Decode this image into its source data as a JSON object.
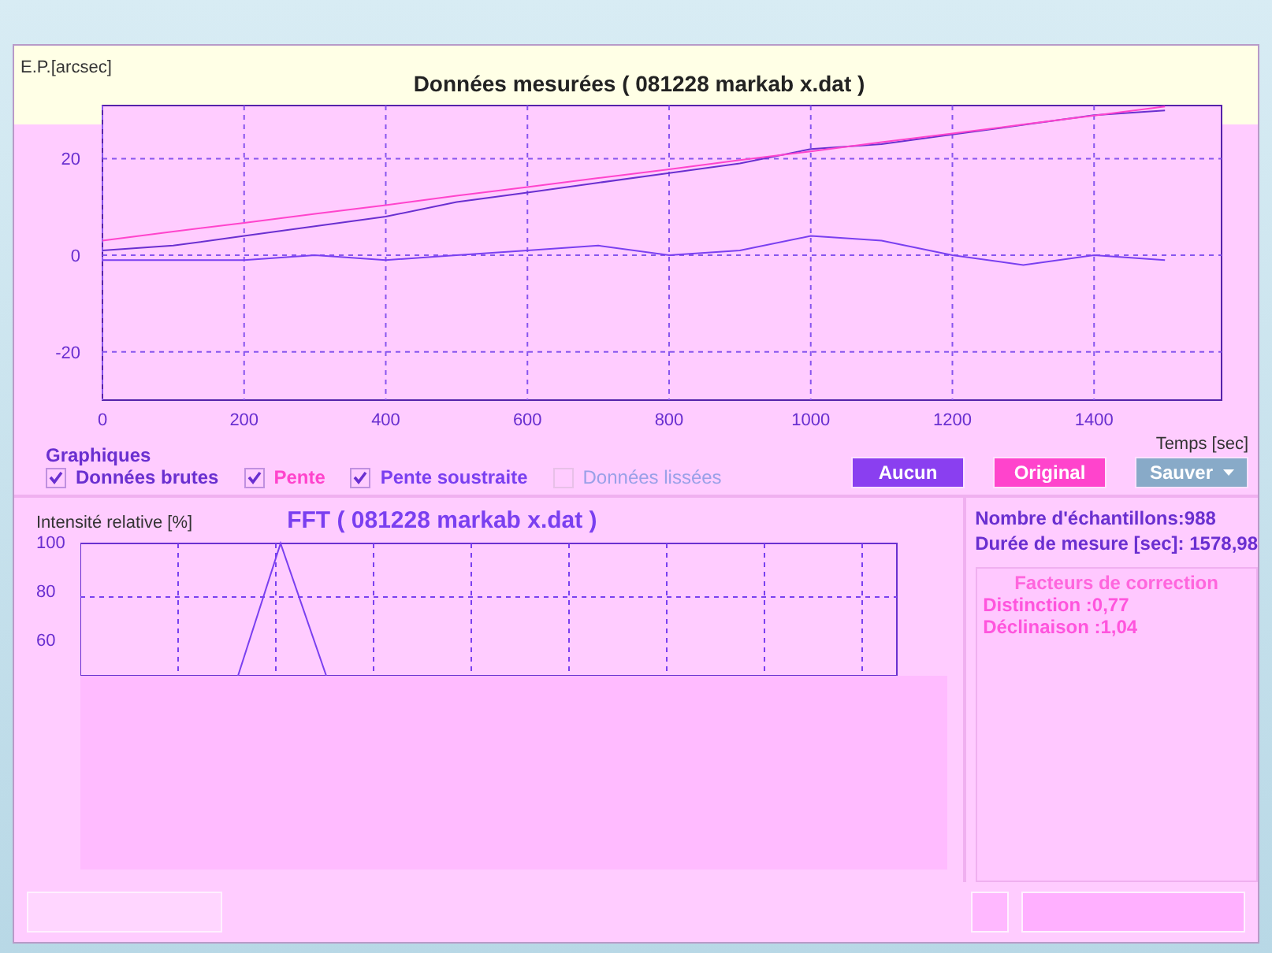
{
  "top_chart": {
    "chart_data": {
      "type": "line",
      "grid": true,
      "title": "Données mesurées ( 081228 markab x.dat )",
      "xlabel": "Temps [sec]",
      "ylabel": "E.P.[arcsec]",
      "x": [
        0,
        100,
        200,
        300,
        400,
        500,
        600,
        700,
        800,
        900,
        1000,
        1100,
        1200,
        1300,
        1400,
        1500
      ],
      "xlim": [
        0,
        1580
      ],
      "ylim": [
        -30,
        31
      ],
      "xticks": [
        0,
        200,
        400,
        600,
        800,
        1000,
        1200,
        1400
      ],
      "yticks": [
        -20,
        0,
        20
      ],
      "series": [
        {
          "color": "#6a2fd0",
          "values": [
            1,
            2,
            4,
            6,
            8,
            11,
            13,
            15,
            17,
            19,
            22,
            23,
            25,
            27,
            29,
            30
          ]
        },
        {
          "color": "#ff44cc",
          "values": [
            3,
            4.9,
            6.7,
            8.6,
            10.4,
            12.3,
            14.1,
            16,
            17.8,
            19.7,
            21.5,
            23.4,
            25.2,
            27.1,
            28.9,
            30.8
          ]
        },
        {
          "color": "#7a3ff0",
          "values": [
            -1,
            -1,
            -1,
            0,
            -1,
            0,
            1,
            2,
            0,
            1,
            4,
            3,
            0,
            -2,
            0,
            -1
          ]
        }
      ]
    }
  },
  "graphics": {
    "label": "Graphiques",
    "checkboxes": [
      {
        "label": "Données brutes",
        "checked": true,
        "disabled": false,
        "color": "#6a2fd0"
      },
      {
        "label": "Pente",
        "checked": true,
        "disabled": false,
        "color": "#ff44cc"
      },
      {
        "label": "Pente soustraite",
        "checked": true,
        "disabled": false,
        "color": "#7a3ff0"
      },
      {
        "label": "Données lissées",
        "checked": false,
        "disabled": true,
        "color": "#9aa0e8"
      }
    ],
    "buttons": [
      {
        "label": "Aucun",
        "kind": "plain",
        "color": "#8a3ff0"
      },
      {
        "label": "Original",
        "kind": "plain",
        "color": "#ff44cc"
      },
      {
        "label": "Sauver",
        "kind": "dropdown",
        "color": "#88aac8"
      }
    ]
  },
  "fft": {
    "ylabel_text": "Intensité relative [%]",
    "title": "FFT ( 081228 markab x.dat )",
    "yticks": [
      "100",
      "80",
      "60"
    ]
  },
  "info": {
    "lines": [
      "Nombre d'échantillons:988",
      "Durée de mesure [sec]: 1578,98"
    ],
    "correction": {
      "title": "Facteurs de correction",
      "lines": [
        "Distinction :0,77",
        "Déclinaison :1,04"
      ]
    }
  }
}
